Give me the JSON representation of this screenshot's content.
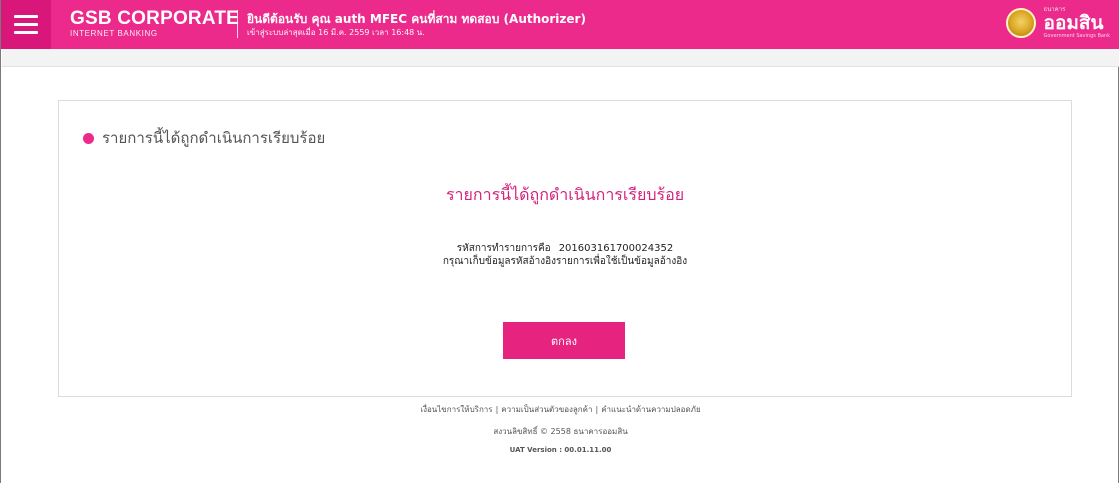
{
  "header": {
    "brand_main": "GSB CORPORATE",
    "brand_sub": "INTERNET BANKING",
    "welcome_text": "ยินดีต้อนรับ คุณ auth MFEC คนที่สาม ทดสอบ (Authorizer)",
    "last_login": "เข้าสู่ระบบล่าสุดเมื่อ 16 มี.ค. 2559 เวลา 16:48 น.",
    "logo_text": "ออมสิน",
    "logo_small": "ธนาคาร",
    "logo_tag": "Government Savings Bank"
  },
  "card": {
    "section_title": "รายการนี้ได้ถูกดำเนินการเรียบร้อย",
    "success_heading": "รายการนี้ได้ถูกดำเนินการเรียบร้อย",
    "ref_label": "รหัสการทำรายการคือ",
    "ref_value": "201603161700024352",
    "note": "กรุณาเก็บข้อมูลรหัสอ้างอิงรายการเพื่อใช้เป็นข้อมูลอ้างอิง",
    "ok_label": "ตกลง"
  },
  "footer": {
    "links": [
      "เงื่อนไขการให้บริการ",
      "ความเป็นส่วนตัวของลูกค้า",
      "คำแนะนำด้านความปลอดภัย"
    ],
    "separator": "|",
    "copyright": "สงวนลิขสิทธิ์ © 2558 ธนาคารออมสิน",
    "version": "UAT Version : 00.01.11.00"
  },
  "colors": {
    "brand_pink": "#ec2a8c",
    "button_pink": "#e6237f",
    "heading_pink": "#d4237d"
  }
}
